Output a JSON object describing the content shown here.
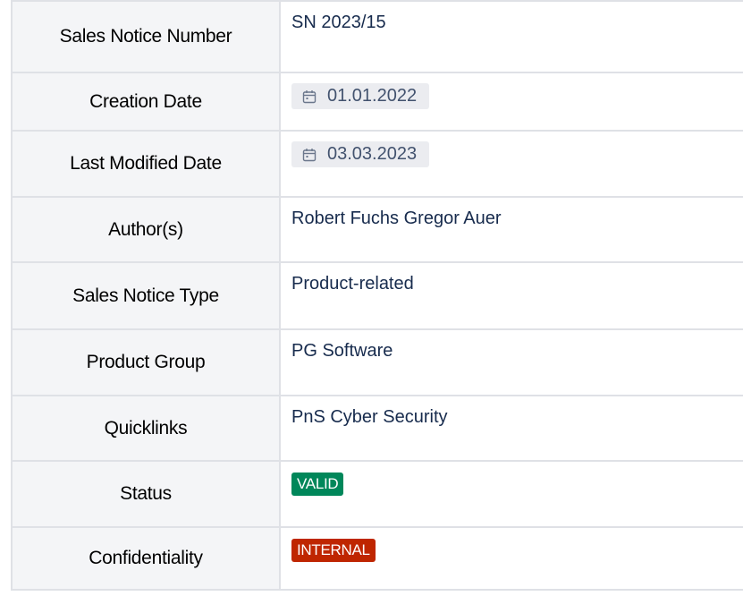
{
  "colors": {
    "status_valid": "#00875a",
    "confidentiality_internal": "#bf2600",
    "key_cell_bg": "#f4f5f7",
    "date_chip_bg": "#ebecf0"
  },
  "rows": [
    {
      "key": "Sales Notice Number",
      "value": "SN 2023/15"
    },
    {
      "key": "Creation Date",
      "value": "01.01.2022",
      "icon": "calendar-icon"
    },
    {
      "key": "Last Modified Date",
      "value": "03.03.2023",
      "icon": "calendar-icon"
    },
    {
      "key": "Author(s)",
      "value": "Robert Fuchs Gregor Auer"
    },
    {
      "key": "Sales Notice Type",
      "value": "Product-related"
    },
    {
      "key": "Product Group",
      "value": "PG Software"
    },
    {
      "key": "Quicklinks",
      "value": "PnS Cyber Security"
    },
    {
      "key": "Status",
      "value": "VALID"
    },
    {
      "key": "Confidentiality",
      "value": "INTERNAL"
    }
  ]
}
